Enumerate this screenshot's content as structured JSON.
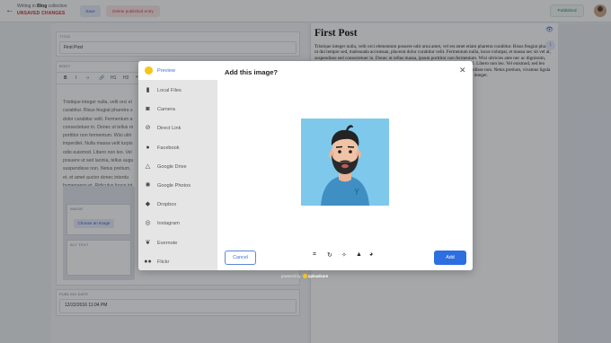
{
  "topbar": {
    "back_icon": "arrow-left-icon",
    "collection_prefix": "Writing in",
    "collection_name": "Blog",
    "collection_suffix": "collection",
    "unsaved": "UNSAVED CHANGES",
    "save_label": "Save",
    "delete_label": "Delete published entry",
    "status_label": "Published",
    "avatar_icon": "user-avatar-icon"
  },
  "editor": {
    "title_field": {
      "label": "TITLE",
      "value": "First Post"
    },
    "body_field": {
      "label": "BODY",
      "toolbar": [
        "B",
        "I",
        "‹›",
        "🔗",
        "H1",
        "H2",
        "❝",
        "•"
      ],
      "text_lines": [
        "Tristique integer nulla, velit orci el",
        "curabitur. Risus feugiat pharetra s",
        "dolor curabitur velit. Fermentum a",
        "consectetuer in. Donec ut tellus m",
        "porttitor non fermentum. Wisi ultri",
        "imperdiet. Nulla massa velit turpis",
        "odio euismod. Libero non leo. Vel",
        "posuere ut sed lacinia, tellus augu",
        "suspendisse non. Netus pretium,",
        "et, et amet auctor donec interdu",
        "hymenaeos et. Ridiculus fusce int"
      ],
      "image_widget": {
        "image_label": "IMAGE",
        "choose_label": "Choose an image",
        "alt_label": "ALT TEXT"
      }
    },
    "date_field": {
      "label": "PUBLISH DATE",
      "value": "12/22/2016 11:04 PM"
    }
  },
  "preview": {
    "title": "First Post",
    "body": "Tristique integer nulla, velit orci elementum posuere odit urna amet, vel est amet etiam pharetra curabitur. Risus feugiat pharetra ut dui tempor sed, malesuada accumsan, placerat dolor curabitur velit. Fermentum nulla, lacus volutpat, et massa nec sit vel at, suspendisse sed consectetuer in. Donec ut tellus massa, ipsum porttitor non fermentum. Wisi ultricies ante nec ac dignissim, imperdiet. Nulla massa velit turpis, rutrum sagittis ac, a pretius, egestas odio euismod. Libero non leo. Vel euismod, sed leo magna dolor et posuere ut sed lacinia, tellus augue non lacinia, quam vel amet suspendisse non. Netus pretium, vivamus ligula dictum vel, et amet et, et amet auctor donec interdum, hymenaeos et. Ridiculus fusce integer."
  },
  "modal": {
    "title": "Add this image?",
    "close_icon": "close-icon",
    "sources": [
      {
        "label": "Preview",
        "icon": "preview-dot-icon",
        "active": true
      },
      {
        "label": "Local Files",
        "icon": "file-icon",
        "active": false
      },
      {
        "label": "Camera",
        "icon": "camera-icon",
        "active": false
      },
      {
        "label": "Direct Link",
        "icon": "link-icon",
        "active": false
      },
      {
        "label": "Facebook",
        "icon": "facebook-icon",
        "active": false
      },
      {
        "label": "Google Drive",
        "icon": "google-drive-icon",
        "active": false
      },
      {
        "label": "Google Photos",
        "icon": "google-photos-icon",
        "active": false
      },
      {
        "label": "Dropbox",
        "icon": "dropbox-icon",
        "active": false
      },
      {
        "label": "Instagram",
        "icon": "instagram-icon",
        "active": false
      },
      {
        "label": "Evernote",
        "icon": "evernote-icon",
        "active": false
      },
      {
        "label": "Flickr",
        "icon": "flickr-icon",
        "active": false
      }
    ],
    "tools": [
      "crop-icon",
      "rotate-icon",
      "enhance-icon",
      "sharpen-icon",
      "grayscale-icon"
    ],
    "cancel_label": "Cancel",
    "add_label": "Add",
    "powered_prefix": "powered by",
    "powered_brand": "uploadcare"
  },
  "colors": {
    "accent": "#2d6fe0",
    "danger": "#c83232",
    "image_bg": "#7ec8ec"
  }
}
